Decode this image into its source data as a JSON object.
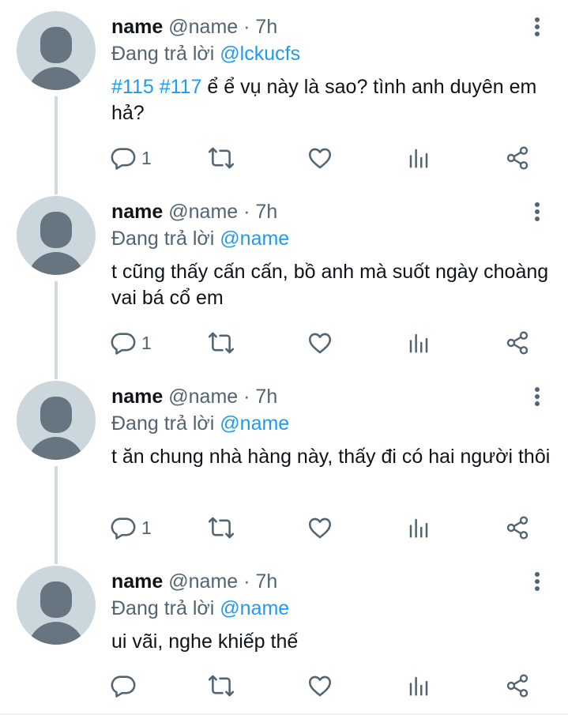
{
  "tweets": [
    {
      "name": "name",
      "handle": "@name",
      "dot": "·",
      "time": "7h",
      "reply_prefix": "Đang trả lời",
      "reply_mention": "@lckucfs",
      "hashtag1": "#115",
      "hashtag2": "#117",
      "text": " ể ể vụ này là sao? tình anh duyên em hả?",
      "reply_count": "1"
    },
    {
      "name": "name",
      "handle": "@name",
      "dot": "·",
      "time": "7h",
      "reply_prefix": "Đang trả lời",
      "reply_mention": "@name",
      "text": "t cũng thấy cấn cấn, bồ anh mà suốt ngày choàng vai bá cổ em",
      "reply_count": "1"
    },
    {
      "name": "name",
      "handle": "@name",
      "dot": "·",
      "time": "7h",
      "reply_prefix": "Đang trả lời",
      "reply_mention": "@name",
      "text": "t ăn chung nhà hàng này, thấy đi có hai người thôi",
      "reply_count": "1"
    },
    {
      "name": "name",
      "handle": "@name",
      "dot": "·",
      "time": "7h",
      "reply_prefix": "Đang trả lời",
      "reply_mention": "@name",
      "text": "ui vãi, nghe khiếp thế",
      "reply_count": ""
    }
  ],
  "icons": {
    "reply": "reply-icon",
    "retweet": "retweet-icon",
    "like": "heart-icon",
    "views": "analytics-icon",
    "share": "share-icon",
    "more": "more-vertical-icon"
  },
  "colors": {
    "accent": "#1d9bf0",
    "secondary_text": "#536471",
    "avatar_bg": "#ccd6dd",
    "avatar_fg": "#66757f",
    "thread_line": "#cfd9de"
  }
}
